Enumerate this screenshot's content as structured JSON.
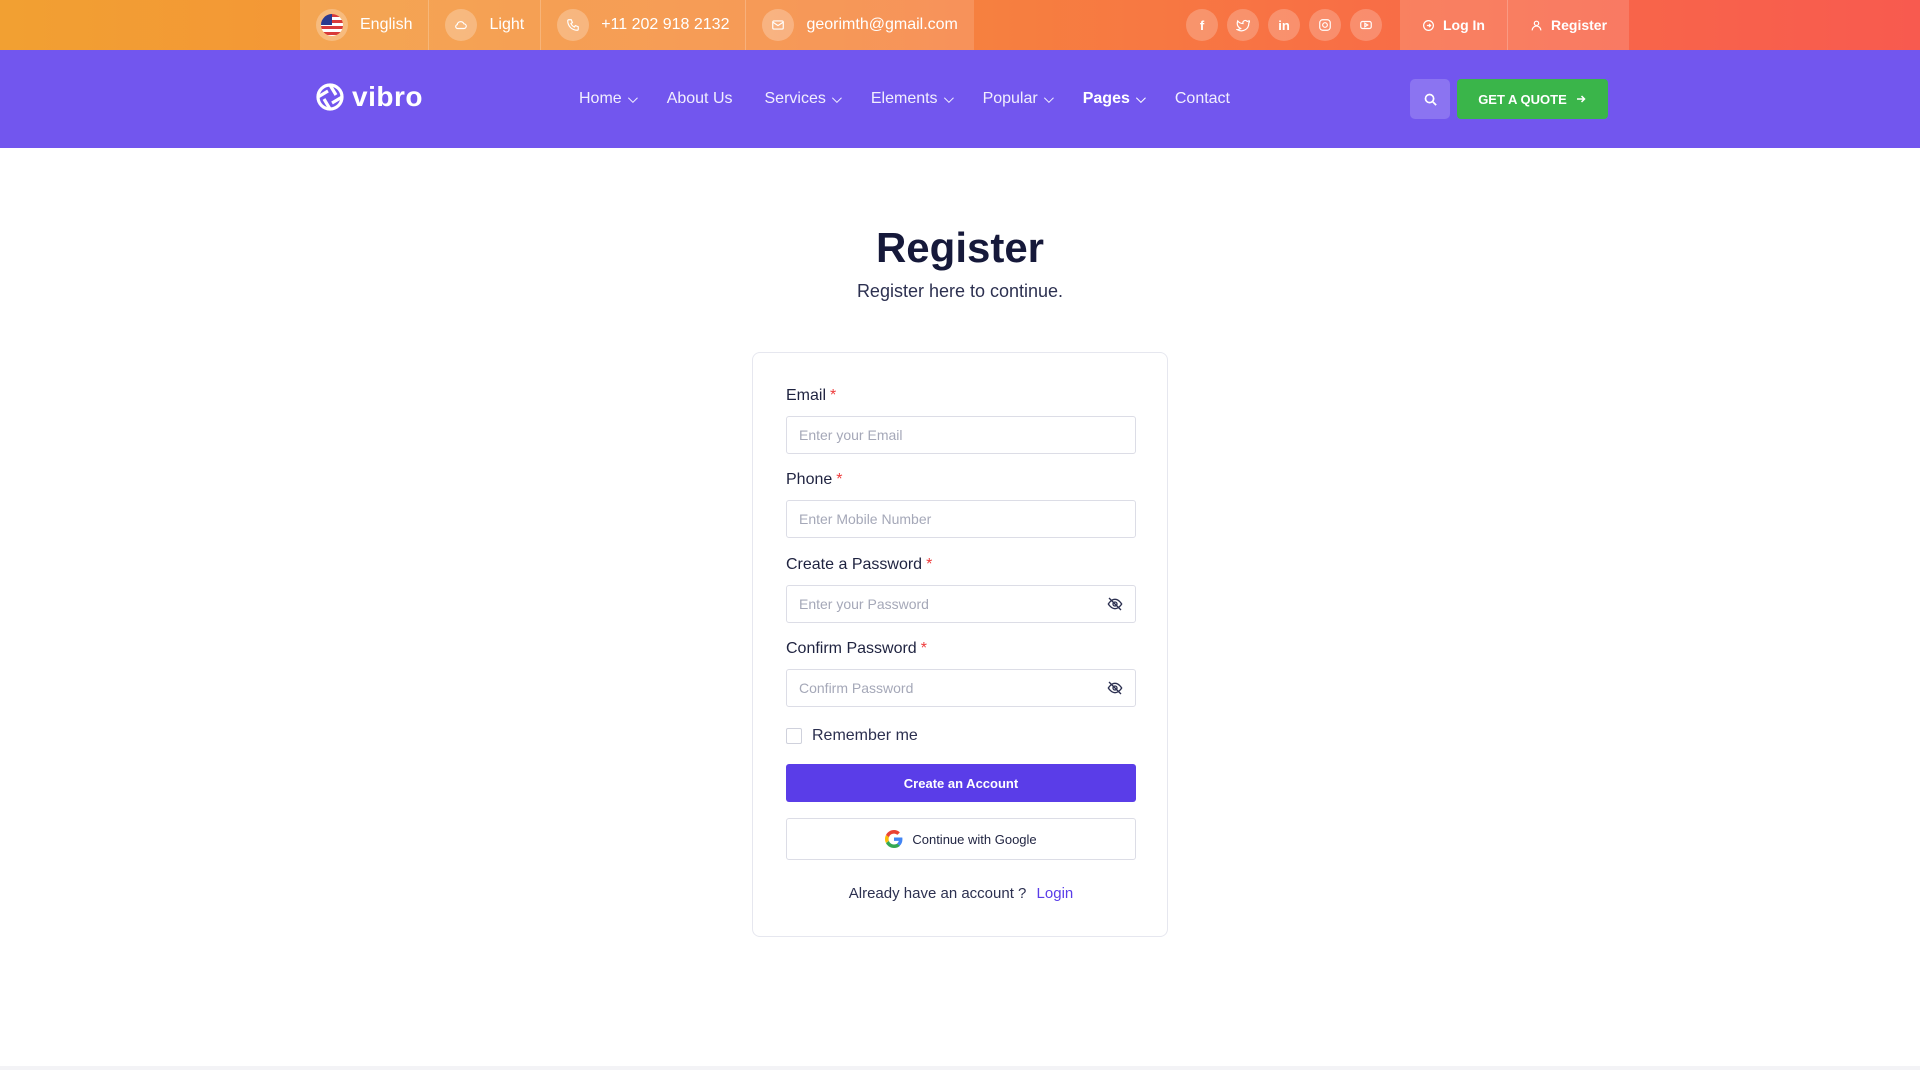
{
  "topbar": {
    "language": "English",
    "theme": "Light",
    "phone": "+11 202 918 2132",
    "email": "georimth@gmail.com",
    "social": [
      {
        "icon": "facebook-icon",
        "glyph": "f"
      },
      {
        "icon": "twitter-icon",
        "glyph": "t"
      },
      {
        "icon": "linkedin-icon",
        "glyph": "in"
      },
      {
        "icon": "instagram-icon",
        "glyph": "ig"
      },
      {
        "icon": "youtube-icon",
        "glyph": "yt"
      }
    ],
    "login_label": "Log In",
    "register_label": "Register",
    "colors": {
      "gradient_start": "#f2a032",
      "gradient_end": "#f85a4f"
    }
  },
  "nav": {
    "logo_text": "vibro",
    "links": [
      {
        "label": "Home",
        "dropdown": true
      },
      {
        "label": "About Us",
        "dropdown": false
      },
      {
        "label": "Services",
        "dropdown": true
      },
      {
        "label": "Elements",
        "dropdown": true
      },
      {
        "label": "Popular",
        "dropdown": true
      },
      {
        "label": "Pages",
        "dropdown": true,
        "active": true
      },
      {
        "label": "Contact",
        "dropdown": false
      }
    ],
    "quote_label": "GET A QUOTE",
    "colors": {
      "background": "#7256ee",
      "quote_button": "#3ab54a"
    }
  },
  "page": {
    "title": "Register",
    "subtitle": "Register here to continue."
  },
  "form": {
    "email": {
      "label": "Email",
      "required": "*",
      "placeholder": "Enter your Email",
      "value": ""
    },
    "phone": {
      "label": "Phone",
      "required": "*",
      "placeholder": "Enter Mobile Number",
      "value": ""
    },
    "password": {
      "label": "Create a Password",
      "required": "*",
      "placeholder": "Enter your Password",
      "value": ""
    },
    "confirm": {
      "label": "Confirm Password",
      "required": "*",
      "placeholder": "Confirm Password",
      "value": ""
    },
    "remember_label": "Remember me",
    "remember_checked": false,
    "create_label": "Create an Account",
    "google_label": "Continue with Google",
    "already_text": "Already have an account ?",
    "login_link": "Login",
    "colors": {
      "primary": "#5a3de8",
      "required": "#ee3b3b"
    }
  }
}
